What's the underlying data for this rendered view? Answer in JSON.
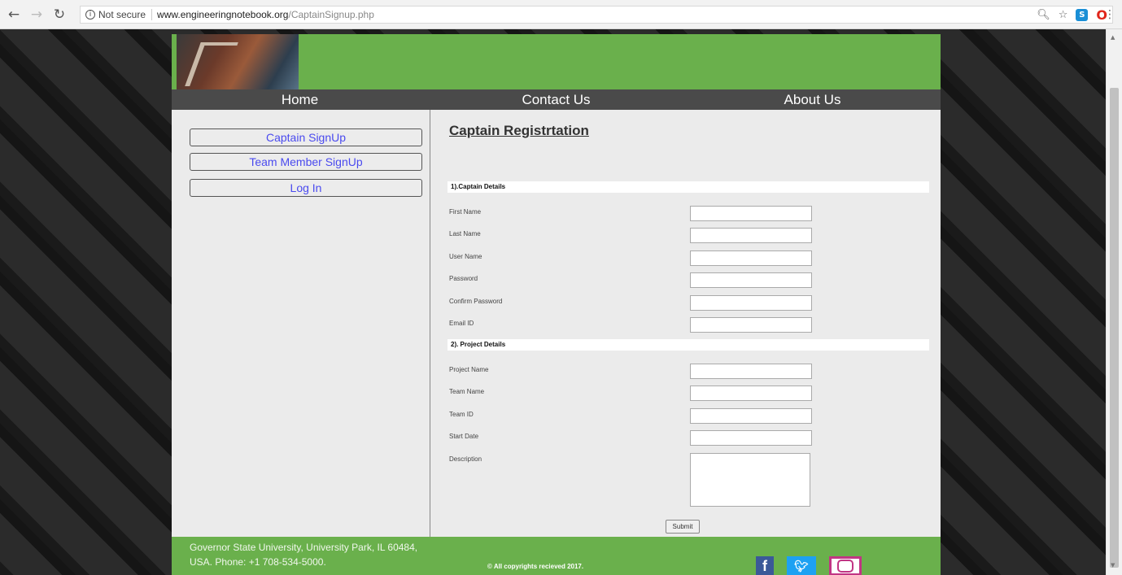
{
  "browser": {
    "security": "Not secure",
    "url_host": "www.engineeringnotebook.org",
    "url_path": "/CaptainSignup.php"
  },
  "nav": {
    "home": "Home",
    "contact": "Contact Us",
    "about": "About Us"
  },
  "sidebar": {
    "captain": "Captain SignUp",
    "member": "Team Member SignUp",
    "login": "Log In"
  },
  "form": {
    "title": "Captain Registrtation",
    "section1": "1).Captain Details",
    "section2": "2). Project Details",
    "first_name": "First Name",
    "last_name": "Last Name",
    "user_name": "User Name",
    "password": "Password",
    "confirm_password": "Confirm Password",
    "email": "Email ID",
    "project_name": "Project Name",
    "team_name": "Team Name",
    "team_id": "Team ID",
    "start_date": "Start Date",
    "description": "Description",
    "submit": "Submit"
  },
  "footer": {
    "address": "Governor State University, University Park, IL 60484, USA. Phone: +1 708-534-5000.",
    "copyright": "© All copyrights recieved 2017."
  },
  "icons": {
    "facebook": "facebook-icon",
    "twitter": "twitter-icon",
    "instagram": "instagram-icon"
  },
  "colors": {
    "green": "#6ab04c",
    "nav": "#4a4a4a",
    "link": "#4a4aef"
  }
}
